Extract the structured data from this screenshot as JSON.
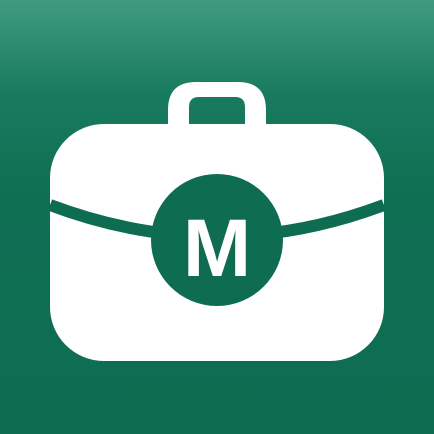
{
  "icon": {
    "name": "briefcase-logo-icon",
    "letter": "M",
    "colors": {
      "background_top": "#3f9b7f",
      "background_main": "#0e6c51",
      "glyph": "#ffffff",
      "emblem": "#0e6c51"
    }
  }
}
